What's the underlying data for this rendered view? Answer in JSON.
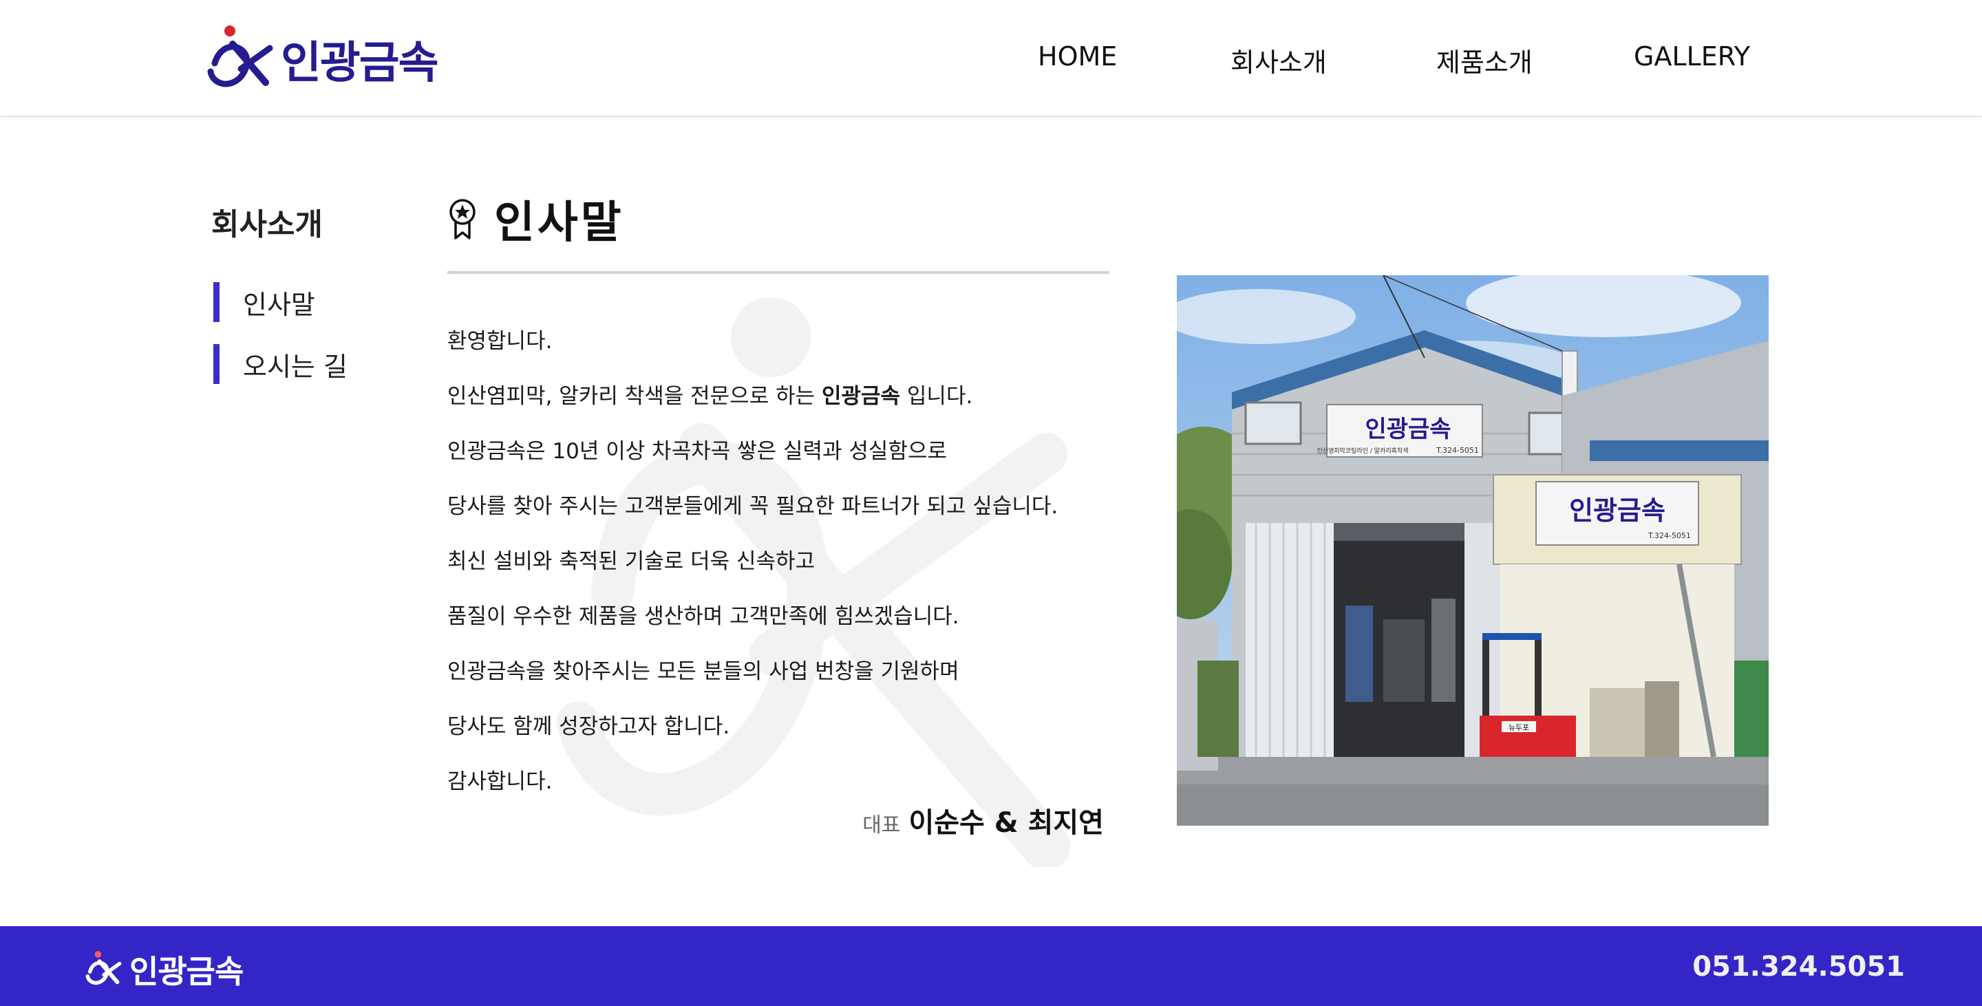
{
  "header": {
    "logo_text": "인광금속",
    "nav": [
      {
        "label": "HOME"
      },
      {
        "label": "회사소개"
      },
      {
        "label": "제품소개"
      },
      {
        "label": "GALLERY"
      }
    ]
  },
  "sidebar": {
    "title": "회사소개",
    "items": [
      {
        "label": "인사말"
      },
      {
        "label": "오시는 길"
      }
    ],
    "accent_color": "#3a2ec9"
  },
  "main": {
    "section_icon": "award-ribbon-icon",
    "title": "인사말",
    "greeting_lines": [
      "환영합니다.",
      {
        "before": "인산염피막, 알카리 착색을 전문으로 하는 ",
        "bold": "인광금속",
        "after": " 입니다."
      },
      "인광금속은 10년 이상 차곡차곡 쌓은 실력과 성실함으로",
      "당사를 찾아 주시는 고객분들에게 꼭 필요한 파트너가 되고 싶습니다.",
      "최신 설비와 축적된 기술로 더욱 신속하고",
      "품질이 우수한 제품을 생산하며 고객만족에 힘쓰겠습니다.",
      "인광금속을 찾아주시는 모든 분들의 사업 번창을 기원하며",
      "당사도 함께 성장하고자 합니다.",
      "감사합니다."
    ],
    "signature_label": "대표",
    "signature_names": "이순수 & 최지연",
    "photo": {
      "sign_text": "인광금속",
      "sign_sub": "인산염피막코팅라인 / 알카리흑착색",
      "sign_phone": "T.324-5051",
      "forklift_label": "뉴두포"
    }
  },
  "footer": {
    "logo_text": "인광금속",
    "phone": "051.324.5051",
    "background_color": "#3426c6"
  }
}
